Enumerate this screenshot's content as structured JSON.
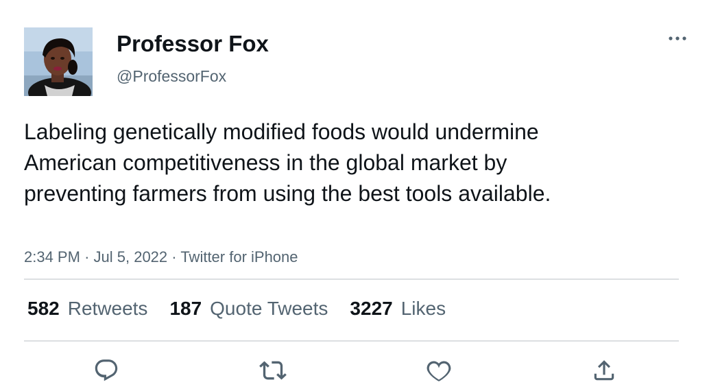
{
  "author": {
    "display_name": "Professor Fox",
    "handle": "@ProfessorFox",
    "avatar_icon": "profile-photo"
  },
  "tweet": {
    "text": "Labeling genetically modified foods would undermine American competitiveness in the global market by preventing farmers from using the best tools available.",
    "time": "2:34 PM",
    "separator": "·",
    "date": "Jul 5, 2022",
    "source": "Twitter for iPhone"
  },
  "stats": {
    "retweets": {
      "count": "582",
      "label": "Retweets"
    },
    "quote_tweets": {
      "count": "187",
      "label": "Quote Tweets"
    },
    "likes": {
      "count": "3227",
      "label": "Likes"
    }
  },
  "actions": {
    "reply_icon": "reply-icon",
    "retweet_icon": "retweet-icon",
    "like_icon": "heart-icon",
    "share_icon": "share-icon",
    "more_icon": "more-icon"
  },
  "colors": {
    "text_primary": "#0f1419",
    "text_secondary": "#536471",
    "divider": "#dcdfe2"
  }
}
